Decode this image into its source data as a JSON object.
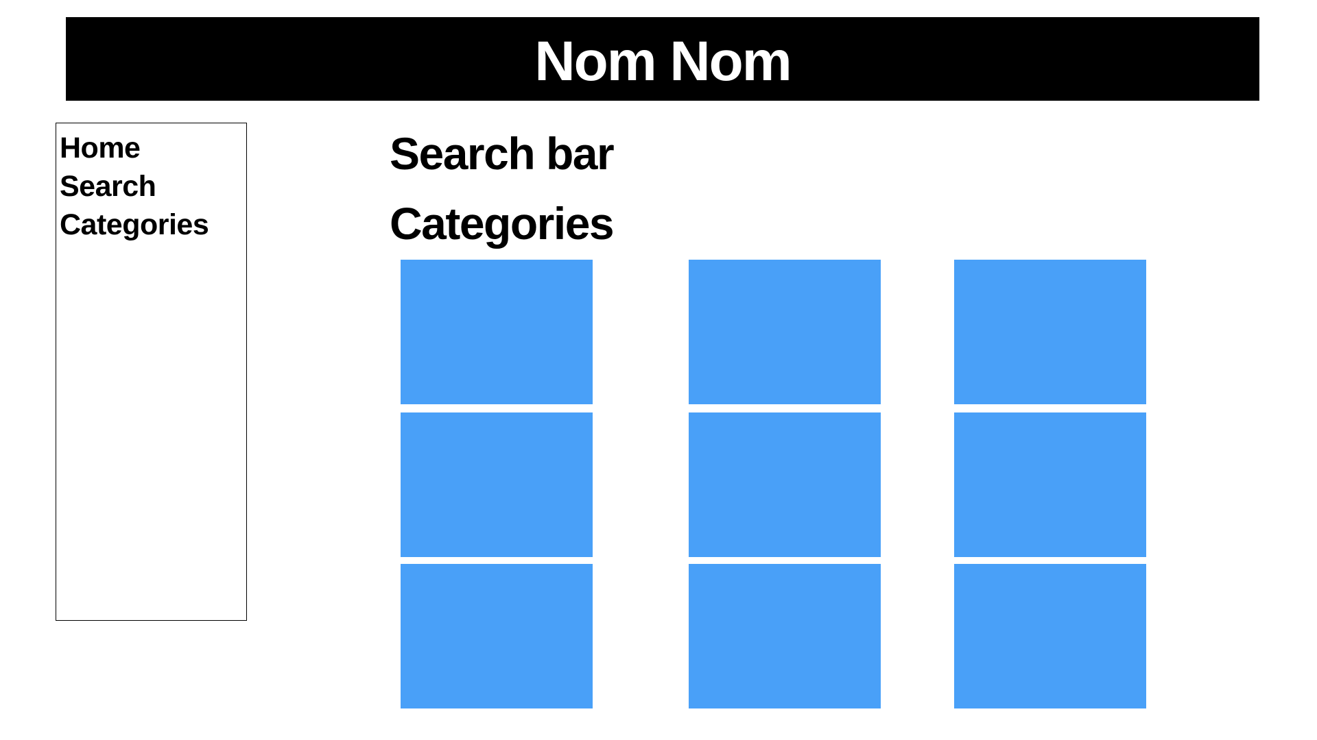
{
  "header": {
    "title": "Nom Nom"
  },
  "sidebar": {
    "items": [
      {
        "label": "Home"
      },
      {
        "label": "Search"
      },
      {
        "label": "Categories"
      }
    ]
  },
  "main": {
    "search_label": "Search bar",
    "categories_label": "Categories",
    "tile_color": "#49A0F8"
  }
}
